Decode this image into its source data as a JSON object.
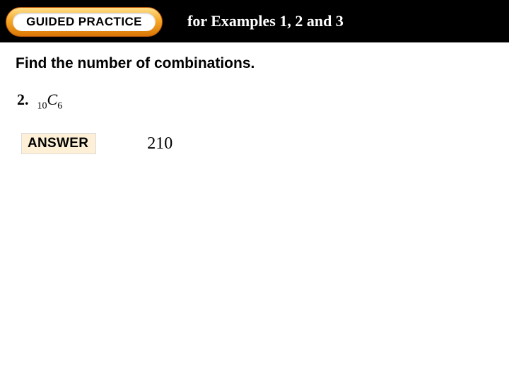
{
  "header": {
    "pill_label": "GUIDED PRACTICE",
    "subtitle": "for Examples 1, 2 and 3"
  },
  "prompt": "Find the number of combinations.",
  "problem": {
    "number": "2.",
    "pre_sub": "10",
    "symbol": "C",
    "post_sub": "6"
  },
  "answer": {
    "label": "ANSWER",
    "value": "210"
  }
}
